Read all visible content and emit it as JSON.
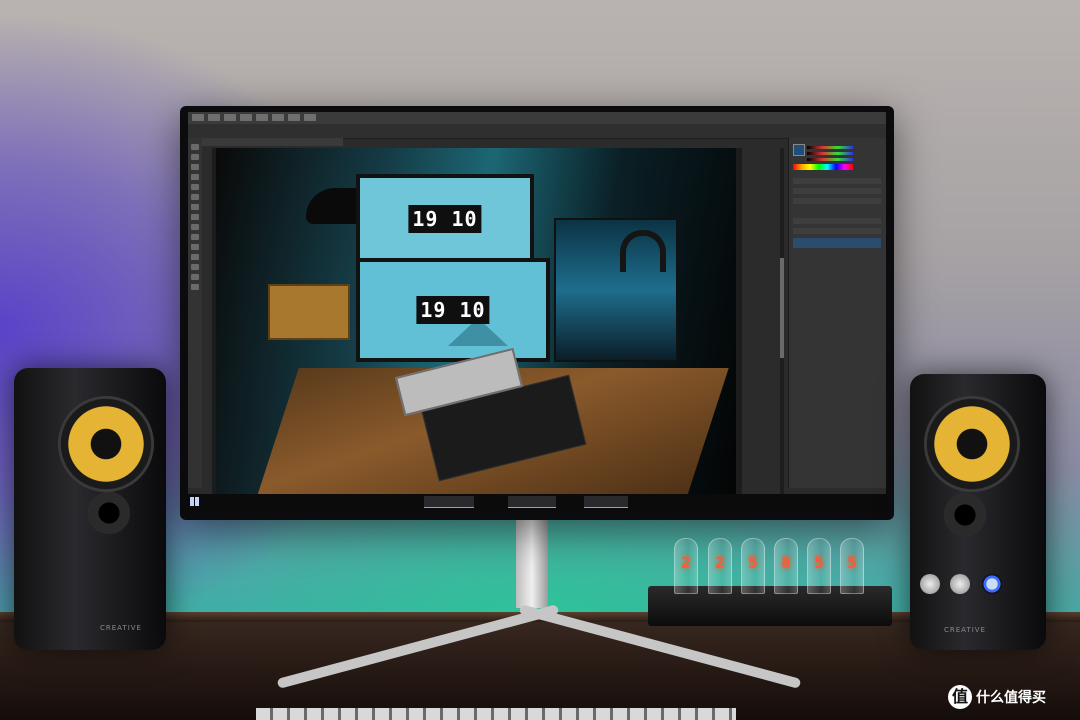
{
  "photo": {
    "top_monitor_clock": "19 10",
    "bottom_monitor_clock": "19 10"
  },
  "nixie_digits": [
    "2",
    "2",
    "5",
    "8",
    "5",
    "5"
  ],
  "speakers": {
    "left_brand": "CREATIVE",
    "right_brand": "CREATIVE"
  },
  "watermark": {
    "logo": "值",
    "text": "什么值得买"
  },
  "colors": {
    "rgb_backlight": "#2ac898",
    "wall_purple": "#5a43c8",
    "nixie_glow": "#ff5a32"
  }
}
